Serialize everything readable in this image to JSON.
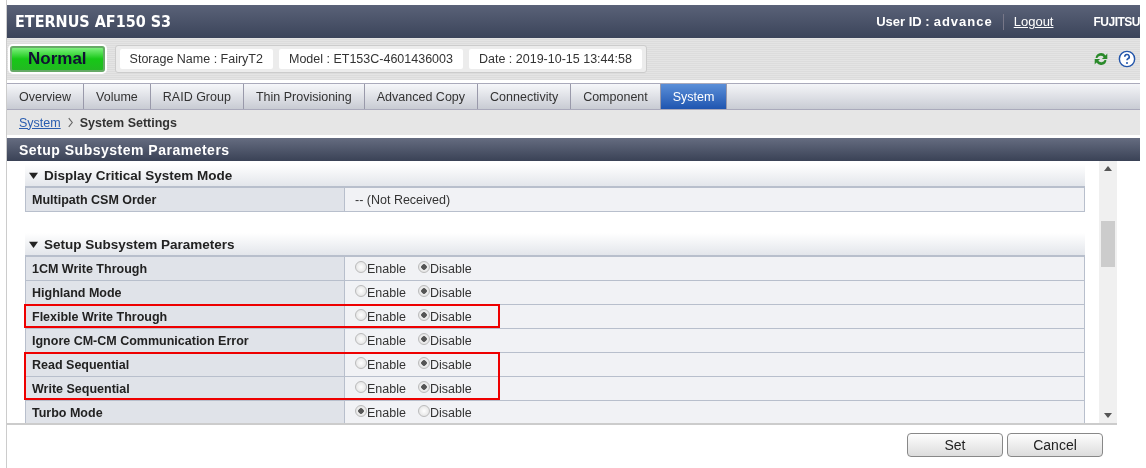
{
  "header": {
    "product": "ETERNUS AF150 S3",
    "user_label": "User ID :",
    "user_id": "advance",
    "logout": "Logout",
    "brand": "FUJITSU"
  },
  "status": {
    "state": "Normal",
    "info": [
      "Storage Name : FairyT2",
      "Model : ET153C-4601436003",
      "Date : 2019-10-15 13:44:58"
    ]
  },
  "tabs": [
    {
      "label": "Overview",
      "selected": false
    },
    {
      "label": "Volume",
      "selected": false
    },
    {
      "label": "RAID Group",
      "selected": false
    },
    {
      "label": "Thin Provisioning",
      "selected": false
    },
    {
      "label": "Advanced Copy",
      "selected": false
    },
    {
      "label": "Connectivity",
      "selected": false
    },
    {
      "label": "Component",
      "selected": false
    },
    {
      "label": "System",
      "selected": true
    }
  ],
  "breadcrumb": {
    "link": "System",
    "current": "System Settings"
  },
  "panel_title": "Setup Subsystem Parameters",
  "sections": [
    {
      "title": "Display Critical System Mode",
      "expanded": true,
      "rows": [
        {
          "kind": "text",
          "label": "Multipath CSM Order",
          "value": "-- (Not Received)",
          "highlighted": false
        }
      ]
    },
    {
      "title": "Setup Subsystem Parameters",
      "expanded": true,
      "rows": [
        {
          "kind": "radio",
          "label": "1CM Write Through",
          "highlighted": false,
          "options": [
            {
              "label": "Enable",
              "selected": false
            },
            {
              "label": "Disable",
              "selected": true
            }
          ]
        },
        {
          "kind": "radio",
          "label": "Highland Mode",
          "highlighted": false,
          "options": [
            {
              "label": "Enable",
              "selected": false
            },
            {
              "label": "Disable",
              "selected": true
            }
          ]
        },
        {
          "kind": "radio",
          "label": "Flexible Write Through",
          "highlighted": true,
          "options": [
            {
              "label": "Enable",
              "selected": false
            },
            {
              "label": "Disable",
              "selected": true
            }
          ]
        },
        {
          "kind": "radio",
          "label": "Ignore CM-CM Communication Error",
          "highlighted": false,
          "options": [
            {
              "label": "Enable",
              "selected": false
            },
            {
              "label": "Disable",
              "selected": true
            }
          ]
        },
        {
          "kind": "radio",
          "label": "Read Sequential",
          "highlighted": true,
          "options": [
            {
              "label": "Enable",
              "selected": false
            },
            {
              "label": "Disable",
              "selected": true
            }
          ]
        },
        {
          "kind": "radio",
          "label": "Write Sequential",
          "highlighted": true,
          "options": [
            {
              "label": "Enable",
              "selected": false
            },
            {
              "label": "Disable",
              "selected": true
            }
          ]
        },
        {
          "kind": "radio",
          "label": "Turbo Mode",
          "highlighted": false,
          "options": [
            {
              "label": "Enable",
              "selected": true
            },
            {
              "label": "Disable",
              "selected": false
            }
          ]
        }
      ]
    }
  ],
  "buttons": [
    "Set",
    "Cancel"
  ]
}
